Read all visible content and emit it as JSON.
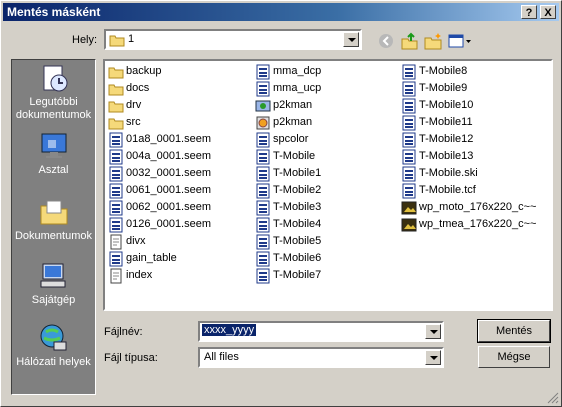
{
  "window": {
    "title": "Mentés másként",
    "help_label": "?",
    "close_label": "X"
  },
  "location": {
    "label": "Hely:",
    "value": "1"
  },
  "places": [
    {
      "name": "place-recent",
      "label1": "Legutóbbi",
      "label2": "dokumentumok",
      "icon": "recent-documents-icon"
    },
    {
      "name": "place-desktop",
      "label1": "Asztal",
      "label2": "",
      "icon": "desktop-icon"
    },
    {
      "name": "place-documents",
      "label1": "Dokumentumok",
      "label2": "",
      "icon": "my-documents-icon"
    },
    {
      "name": "place-computer",
      "label1": "Sajátgép",
      "label2": "",
      "icon": "my-computer-icon"
    },
    {
      "name": "place-network",
      "label1": "Hálózati helyek",
      "label2": "",
      "icon": "network-places-icon"
    }
  ],
  "files": {
    "col1": [
      {
        "name": "backup",
        "type": "folder"
      },
      {
        "name": "docs",
        "type": "folder"
      },
      {
        "name": "drv",
        "type": "folder"
      },
      {
        "name": "src",
        "type": "folder"
      },
      {
        "name": "01a8_0001.seem",
        "type": "doc"
      },
      {
        "name": "004a_0001.seem",
        "type": "doc"
      },
      {
        "name": "0032_0001.seem",
        "type": "doc"
      },
      {
        "name": "0061_0001.seem",
        "type": "doc"
      },
      {
        "name": "0062_0001.seem",
        "type": "doc"
      },
      {
        "name": "0126_0001.seem",
        "type": "doc"
      },
      {
        "name": "divx",
        "type": "text"
      },
      {
        "name": "gain_table",
        "type": "doc"
      },
      {
        "name": "index",
        "type": "text"
      }
    ],
    "col2": [
      {
        "name": "mma_dcp",
        "type": "doc"
      },
      {
        "name": "mma_ucp",
        "type": "doc"
      },
      {
        "name": "p2kman",
        "type": "app"
      },
      {
        "name": "p2kman",
        "type": "setup"
      },
      {
        "name": "spcolor",
        "type": "doc"
      },
      {
        "name": "T-Mobile",
        "type": "doc"
      },
      {
        "name": "T-Mobile1",
        "type": "doc"
      },
      {
        "name": "T-Mobile2",
        "type": "doc"
      },
      {
        "name": "T-Mobile3",
        "type": "doc"
      },
      {
        "name": "T-Mobile4",
        "type": "doc"
      },
      {
        "name": "T-Mobile5",
        "type": "doc"
      },
      {
        "name": "T-Mobile6",
        "type": "doc"
      },
      {
        "name": "T-Mobile7",
        "type": "doc"
      }
    ],
    "col3": [
      {
        "name": "T-Mobile8",
        "type": "doc"
      },
      {
        "name": "T-Mobile9",
        "type": "doc"
      },
      {
        "name": "T-Mobile10",
        "type": "doc"
      },
      {
        "name": "T-Mobile11",
        "type": "doc"
      },
      {
        "name": "T-Mobile12",
        "type": "doc"
      },
      {
        "name": "T-Mobile13",
        "type": "doc"
      },
      {
        "name": "T-Mobile.ski",
        "type": "doc"
      },
      {
        "name": "T-Mobile.tcf",
        "type": "doc"
      },
      {
        "name": "wp_moto_176x220_c~~",
        "type": "image"
      },
      {
        "name": "wp_tmea_176x220_c~~",
        "type": "image"
      }
    ]
  },
  "filename": {
    "label": "Fájlnév:",
    "value": "xxxx_yyyy"
  },
  "filetype": {
    "label": "Fájl típusa:",
    "value": "All files"
  },
  "buttons": {
    "save": "Mentés",
    "cancel": "Mégse"
  },
  "colors": {
    "title_start": "#0a246a",
    "title_end": "#a6caf0",
    "face": "#d4d0c8",
    "selection": "#0a246a"
  }
}
